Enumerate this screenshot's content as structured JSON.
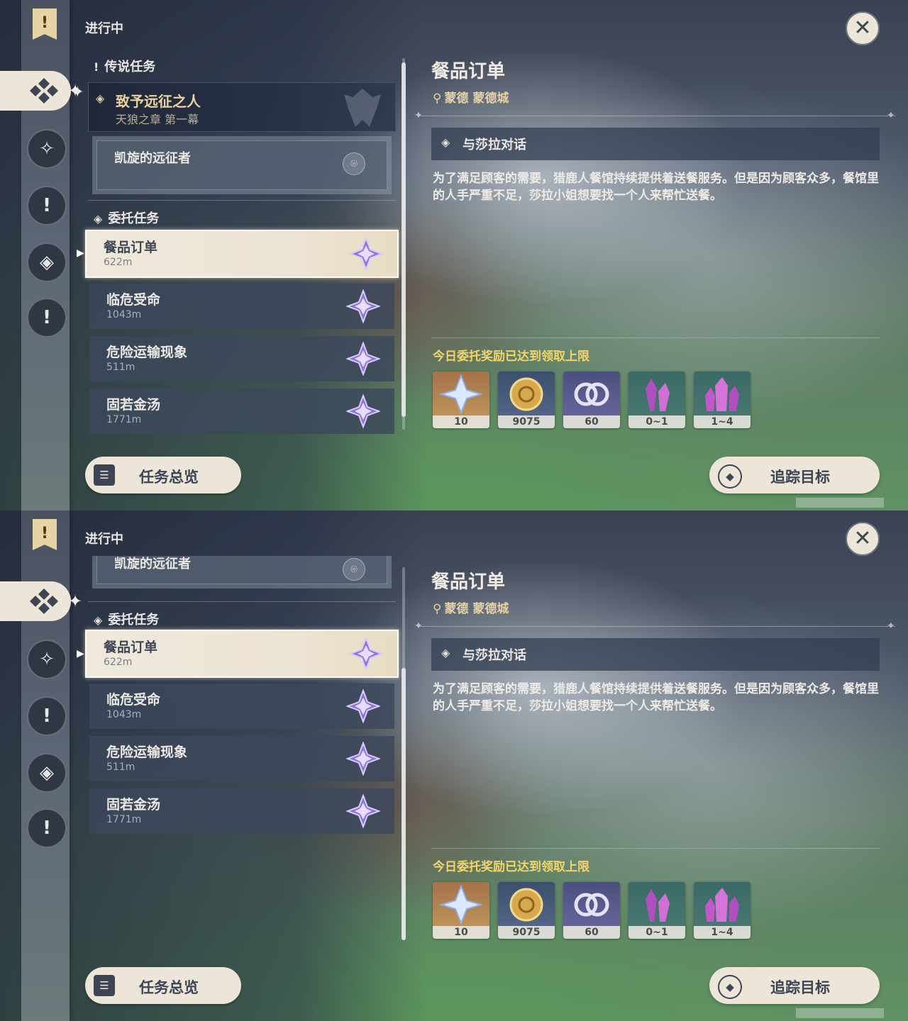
{
  "screens": [
    {
      "status_heading": "进行中",
      "legend_section": {
        "label": "传说任务"
      },
      "legend_quest": {
        "title": "致予远征之人",
        "subtitle": "天狼之章 第一幕"
      },
      "sub_quest": {
        "title": "凯旋的远征者"
      },
      "commission_section": {
        "label": "委托任务"
      },
      "commissions": [
        {
          "name": "餐品订单",
          "distance": "622m",
          "selected": true
        },
        {
          "name": "临危受命",
          "distance": "1043m",
          "selected": false
        },
        {
          "name": "危险运输现象",
          "distance": "511m",
          "selected": false
        },
        {
          "name": "固若金汤",
          "distance": "1771m",
          "selected": false
        }
      ],
      "overview_button": "任务总览",
      "track_button": "追踪目标",
      "detail": {
        "title": "餐品订单",
        "location": "蒙德 蒙德城",
        "objective": "与莎拉对话",
        "description": "为了满足顾客的需要，猎鹿人餐馆持续提供着送餐服务。但是因为顾客众多，餐馆里的人手严重不足，莎拉小姐想要找一个人来帮忙送餐。",
        "reward_cap": "今日委托奖励已达到领取上限",
        "rewards": [
          {
            "icon": "primogem-icon",
            "qty": "10"
          },
          {
            "icon": "mora-coin-icon",
            "qty": "9075"
          },
          {
            "icon": "companionship-exp-icon",
            "qty": "60"
          },
          {
            "icon": "purple-crystal-icon",
            "qty": "0~1"
          },
          {
            "icon": "purple-crystal-cluster-icon",
            "qty": "1~4"
          }
        ]
      }
    },
    {
      "status_heading": "进行中",
      "sub_quest": {
        "title": "凯旋的远征者"
      },
      "commission_section": {
        "label": "委托任务"
      },
      "commissions": [
        {
          "name": "餐品订单",
          "distance": "622m",
          "selected": true
        },
        {
          "name": "临危受命",
          "distance": "1043m",
          "selected": false
        },
        {
          "name": "危险运输现象",
          "distance": "511m",
          "selected": false
        },
        {
          "name": "固若金汤",
          "distance": "1771m",
          "selected": false
        }
      ],
      "overview_button": "任务总览",
      "track_button": "追踪目标",
      "detail": {
        "title": "餐品订单",
        "location": "蒙德 蒙德城",
        "objective": "与莎拉对话",
        "description": "为了满足顾客的需要，猎鹿人餐馆持续提供着送餐服务。但是因为顾客众多，餐馆里的人手严重不足，莎拉小姐想要找一个人来帮忙送餐。",
        "reward_cap": "今日委托奖励已达到领取上限",
        "rewards": [
          {
            "icon": "primogem-icon",
            "qty": "10"
          },
          {
            "icon": "mora-coin-icon",
            "qty": "9075"
          },
          {
            "icon": "companionship-exp-icon",
            "qty": "60"
          },
          {
            "icon": "purple-crystal-icon",
            "qty": "0~1"
          },
          {
            "icon": "purple-crystal-cluster-icon",
            "qty": "1~4"
          }
        ]
      }
    }
  ],
  "colors": {
    "accent_gold": "#e7d2a2",
    "reward_cap_yellow": "#f3d56a",
    "button_cream": "#ece5d8",
    "panel_dark": "#3c485c"
  }
}
